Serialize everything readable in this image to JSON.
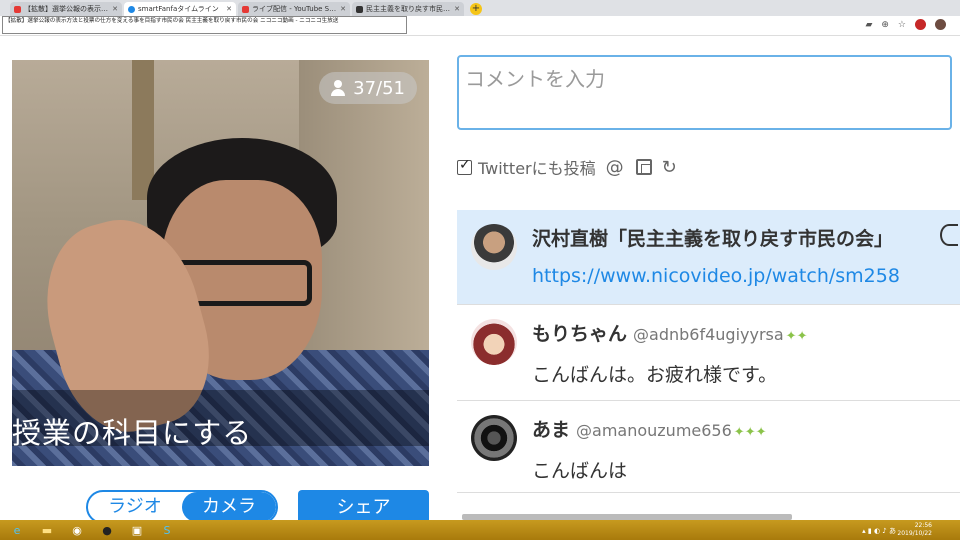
{
  "browser": {
    "tabs": [
      {
        "title": "【拡散】選挙公報の表示方法が人道に反するか否か",
        "favicon_color": "#e53935",
        "active": false
      },
      {
        "title": "smartFanfaタイムライン",
        "favicon_color": "#1e88e5",
        "active": true
      },
      {
        "title": "ライブ配信 - YouTube Studio",
        "favicon_color": "#e53935",
        "active": false
      },
      {
        "title": "民主主義を取り戻す市民の会",
        "favicon_color": "#333333",
        "active": false
      }
    ],
    "new_tab_label": "+",
    "tooltip": "【拡散】選挙公報の表示方法と投票の仕方を変える事を目指す市民の会 民主主義を取り戻す市民の会 ニコニコ動画 - ニコニコ生放送"
  },
  "video": {
    "viewer_count": "37/51",
    "caption": "授業の科目にする"
  },
  "controls": {
    "mode_options": [
      "ラジオ",
      "カメラ"
    ],
    "share_label": "シェア"
  },
  "comment_form": {
    "placeholder": "コメントを入力",
    "twitter_label": "Twitterにも投稿",
    "mention_icon": "@"
  },
  "comments": [
    {
      "name": "沢村直樹「民主主義を取り戻す市民の会」",
      "handle": "",
      "badges": "",
      "body": "https://www.nicovideo.jp/watch/sm258",
      "is_link": true
    },
    {
      "name": "もりちゃん",
      "handle": "@adnb6f4ugiyyrsa",
      "badges": "✦✦",
      "body": "こんばんは。お疲れ様です。",
      "is_link": false
    },
    {
      "name": "あま",
      "handle": "@amanouzume656",
      "badges": "✦✦✦",
      "body": "こんばんは",
      "is_link": false
    }
  ],
  "taskbar": {
    "clock_time": "22:56",
    "clock_date": "2019/10/22"
  },
  "colors": {
    "accent": "#1e88e5",
    "highlight_bg": "#dcecfb",
    "taskbar": "#b8860b"
  }
}
